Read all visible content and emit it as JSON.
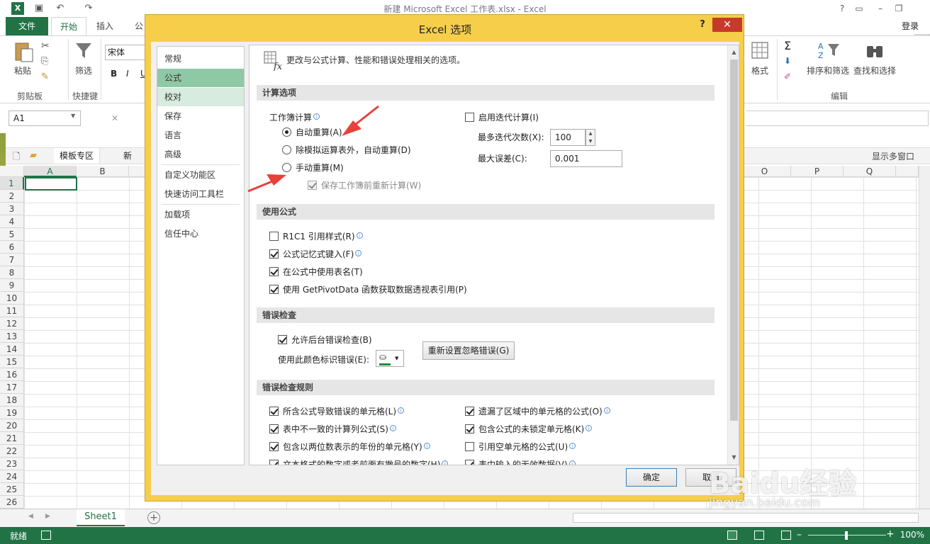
{
  "window": {
    "title": "新建 Microsoft Excel 工作表.xlsx - Excel",
    "login": "登录"
  },
  "ribbon": {
    "tabs": [
      "文件",
      "开始",
      "插入",
      "公"
    ],
    "paste": "粘贴",
    "filter": "筛选",
    "font": "宋体",
    "format": "格式",
    "sort_filter": "排序和筛选",
    "find_select": "查找和选择",
    "groups": {
      "clipboard": "剪贴板",
      "shortcut": "快捷键",
      "edit": "编辑"
    }
  },
  "formula_bar": {
    "name_box": "A1"
  },
  "doc_tabs": {
    "template": "模板专区",
    "new": "新",
    "multi_window": "显示多窗口"
  },
  "grid": {
    "columns": [
      "A",
      "B",
      "O",
      "P",
      "Q"
    ],
    "rows": [
      "1",
      "2",
      "3",
      "4",
      "5",
      "6",
      "7",
      "8",
      "9",
      "10",
      "11",
      "12",
      "13",
      "14",
      "15",
      "16",
      "17",
      "18",
      "19",
      "20",
      "21",
      "22",
      "23",
      "24",
      "25",
      "26"
    ]
  },
  "sheet_bar": {
    "sheet": "Sheet1"
  },
  "status": {
    "ready": "就绪",
    "zoom": "100%"
  },
  "dialog": {
    "title": "Excel 选项",
    "help": "?",
    "nav": [
      "常规",
      "公式",
      "校对",
      "保存",
      "语言",
      "高级",
      "自定义功能区",
      "快速访问工具栏",
      "加载项",
      "信任中心"
    ],
    "intro": "更改与公式计算、性能和错误处理相关的选项。",
    "sections": {
      "calc": "计算选项",
      "formulas": "使用公式",
      "error_check": "错误检查",
      "error_rules": "错误检查规则"
    },
    "calc": {
      "workbook_calc": "工作簿计算",
      "auto": "自动重算(A)",
      "auto_except": "除模拟运算表外，自动重算(D)",
      "manual": "手动重算(M)",
      "recalc_before_save": "保存工作簿前重新计算(W)",
      "enable_iterative": "启用迭代计算(I)",
      "max_iterations_label": "最多迭代次数(X):",
      "max_iterations": "100",
      "max_change_label": "最大误差(C):",
      "max_change": "0.001"
    },
    "formulas": {
      "r1c1": "R1C1 引用样式(R)",
      "autocomplete": "公式记忆式键入(F)",
      "table_names": "在公式中使用表名(T)",
      "getpivot": "使用 GetPivotData 函数获取数据透视表引用(P)"
    },
    "error_check": {
      "background": "允许后台错误检查(B)",
      "color_label": "使用此颜色标识错误(E):",
      "reset": "重新设置忽略错误(G)"
    },
    "error_rules": {
      "r1": "所含公式导致错误的单元格(L)",
      "r2": "表中不一致的计算列公式(S)",
      "r3": "包含以两位数表示的年份的单元格(Y)",
      "r4": "文本格式的数字或者前面有撇号的数字(H)",
      "r5": "遗漏了区域中的单元格的公式(O)",
      "r6": "包含公式的未锁定单元格(K)",
      "r7": "引用空单元格的公式(U)",
      "r8": "表中输入的无效数据(V)"
    },
    "ok": "确定",
    "cancel": "取消"
  },
  "watermark": {
    "brand": "Baidu经验",
    "url": "jingyan.baidu.com"
  },
  "colors": {
    "excel_green": "#217346",
    "dialog_frame": "#f6ce4a",
    "nav_selected": "#8fc8a5",
    "annotation_arrow": "#e8413c"
  }
}
